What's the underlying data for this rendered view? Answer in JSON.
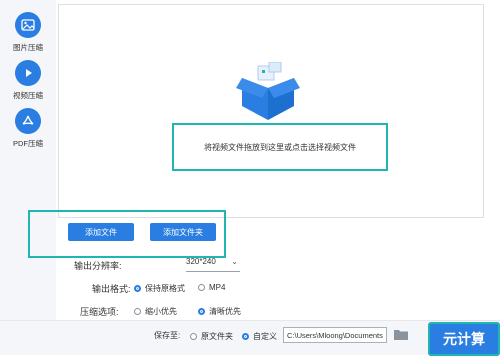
{
  "sidebar": {
    "items": [
      {
        "label": "图片压缩",
        "icon": "image-icon"
      },
      {
        "label": "视频压缩",
        "icon": "play-icon"
      },
      {
        "label": "PDF压缩",
        "icon": "pdf-icon"
      }
    ]
  },
  "drop_zone": {
    "hint": "将视频文件拖放到这里或点击选择视频文件",
    "icon": "box-icon"
  },
  "buttons": {
    "add_file": "添加文件",
    "add_folder": "添加文件夹"
  },
  "settings": {
    "resolution_label": "输出分辨率:",
    "resolution_value": "320*240",
    "format_label": "输出格式:",
    "format_options": [
      "保持原格式",
      "MP4"
    ],
    "format_selected": "保持原格式",
    "compress_label": "压缩选项:",
    "compress_options": [
      "缩小优先",
      "清晰优先"
    ],
    "compress_selected": "清晰优先"
  },
  "footer": {
    "save_label": "保存至:",
    "save_options": [
      "原文件夹",
      "自定义"
    ],
    "save_selected": "自定义",
    "path_value": "C:\\Users\\Mloong\\Documents",
    "start_label": "元计算"
  },
  "colors": {
    "accent": "#2a7de1",
    "highlight": "#1fb5b0"
  }
}
